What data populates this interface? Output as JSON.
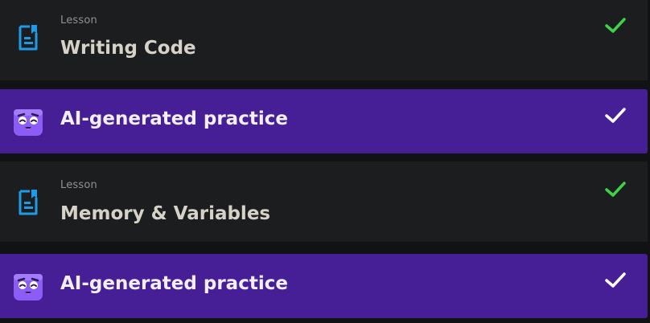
{
  "items": [
    {
      "type": "lesson",
      "eyebrow": "Lesson",
      "title": "Writing Code",
      "icon": "document-icon",
      "completed": true,
      "check_color": "#3fd14a"
    },
    {
      "type": "practice",
      "title": "AI-generated practice",
      "icon": "boots-mascot-icon",
      "completed": true,
      "check_color": "#ffffff"
    },
    {
      "type": "lesson",
      "eyebrow": "Lesson",
      "title": "Memory & Variables",
      "icon": "document-icon",
      "completed": true,
      "check_color": "#3fd14a"
    },
    {
      "type": "practice",
      "title": "AI-generated practice",
      "icon": "boots-mascot-icon",
      "completed": true,
      "check_color": "#ffffff"
    }
  ],
  "colors": {
    "lesson_bg": "#1c1d1f",
    "practice_bg": "#461e96",
    "doc_icon": "#1e9be8",
    "mascot": "#8b5cf6"
  }
}
